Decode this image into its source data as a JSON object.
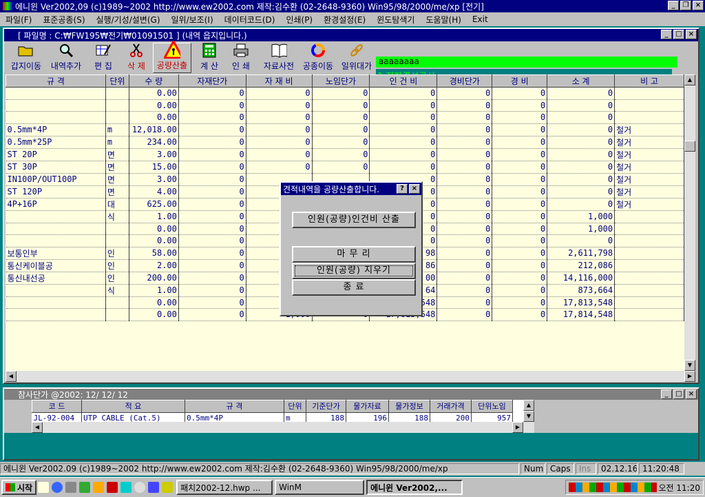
{
  "app": {
    "title": "에니윈 Ver2002,09 (c)1989~2002 http://www.ew2002.com 제작:김수환 (02-2648-9360) Win95/98/2000/me/xp [전기]"
  },
  "menu": [
    "파일(F)",
    "표준공종(S)",
    "실행/기성/설변(G)",
    "일위/보조(I)",
    "데이터코드(D)",
    "인쇄(P)",
    "환경설정(E)",
    "윈도탐색기",
    "도움말(H)",
    "Exit"
  ],
  "doc": {
    "title": "[ 파일명 : C:₩FW195₩전기₩01091501 ] (내역 읍지입니다.)"
  },
  "toolbar": [
    {
      "label": "갑지이동",
      "icon": "folder-open-icon"
    },
    {
      "label": "내역추가",
      "icon": "magnifier-icon"
    },
    {
      "label": "편 집",
      "icon": "edit-sheet-icon"
    },
    {
      "label": "삭 제",
      "icon": "scissors-icon"
    },
    {
      "label": "공량산출",
      "icon": "warning-worker-icon"
    },
    {
      "label": "계 산",
      "icon": "calculator-icon"
    },
    {
      "label": "인 쇄",
      "icon": "printer-icon"
    },
    {
      "label": "자료사전",
      "icon": "book-icon"
    },
    {
      "label": "공종이동",
      "icon": "color-ring-icon"
    },
    {
      "label": "일위대가",
      "icon": "chain-icon"
    }
  ],
  "status": {
    "line1": "aaaaaaaa",
    "line2": "1 전화결선공사"
  },
  "grid": {
    "headers": [
      "규  격",
      "단위",
      "수  량",
      "자재단가",
      "자 재 비",
      "노임단가",
      "인 건 비",
      "경비단가",
      "경  비",
      "소  계",
      "비  고"
    ],
    "rows": [
      [
        "",
        "",
        "0.00",
        "0",
        "0",
        "0",
        "0",
        "0",
        "0",
        "0",
        ""
      ],
      [
        "",
        "",
        "0.00",
        "0",
        "0",
        "0",
        "0",
        "0",
        "0",
        "0",
        ""
      ],
      [
        "",
        "",
        "0.00",
        "0",
        "0",
        "0",
        "0",
        "0",
        "0",
        "0",
        ""
      ],
      [
        "0.5mm*4P",
        "m",
        "12,018.00",
        "0",
        "0",
        "0",
        "0",
        "0",
        "0",
        "0",
        "철거"
      ],
      [
        "0.5mm*25P",
        "m",
        "234.00",
        "0",
        "0",
        "0",
        "0",
        "0",
        "0",
        "0",
        "철거"
      ],
      [
        "ST    20P",
        "면",
        "3.00",
        "0",
        "0",
        "0",
        "0",
        "0",
        "0",
        "0",
        "철거"
      ],
      [
        "ST    30P",
        "면",
        "15.00",
        "0",
        "0",
        "0",
        "0",
        "0",
        "0",
        "0",
        "철거"
      ],
      [
        "IN100P/OUT100P",
        "면",
        "3.00",
        "0",
        "",
        "",
        "0",
        "0",
        "0",
        "0",
        "철거"
      ],
      [
        "ST    120P",
        "면",
        "4.00",
        "0",
        "",
        "",
        "0",
        "0",
        "0",
        "0",
        "철거"
      ],
      [
        "4P+16P",
        "대",
        "625.00",
        "0",
        "",
        "",
        "0",
        "0",
        "0",
        "0",
        "철거"
      ],
      [
        "",
        "식",
        "1.00",
        "0",
        "",
        "",
        "0",
        "0",
        "0",
        "1,000",
        ""
      ],
      [
        "",
        "",
        "0.00",
        "0",
        "",
        "",
        "0",
        "0",
        "0",
        "1,000",
        ""
      ],
      [
        "",
        "",
        "0.00",
        "0",
        "",
        "",
        "0",
        "0",
        "0",
        "0",
        ""
      ],
      [
        "보통인부",
        "인",
        "58.00",
        "0",
        "",
        "",
        "98",
        "0",
        "0",
        "2,611,798",
        ""
      ],
      [
        "통신케이블공",
        "인",
        "2.00",
        "0",
        "",
        "",
        "86",
        "0",
        "0",
        "212,086",
        ""
      ],
      [
        "통신내선공",
        "인",
        "200.00",
        "0",
        "",
        "",
        "00",
        "0",
        "0",
        "14,116,000",
        ""
      ],
      [
        "",
        "식",
        "1.00",
        "0",
        "",
        "",
        "64",
        "0",
        "0",
        "873,664",
        ""
      ],
      [
        "",
        "",
        "0.00",
        "0",
        "",
        "",
        "548",
        "0",
        "0",
        "17,813,548",
        ""
      ],
      [
        "",
        "",
        "0.00",
        "0",
        "1,000",
        "0",
        "17,813,548",
        "0",
        "0",
        "17,814,548",
        ""
      ]
    ]
  },
  "dialog": {
    "title": "견적내역을 공량산출합니다.",
    "btn_calc": "인원(공량)인건비 산출",
    "btn_finish": "마 무 리",
    "btn_clear": "인원(공량) 지우기",
    "btn_close": "종  료"
  },
  "sub": {
    "title": "참사단가  @2002: 12/ 12/ 12",
    "headers": [
      "코  드",
      "적  요",
      "규  격",
      "단위",
      "기준단가",
      "물가자료",
      "물가정보",
      "거래가격",
      "단위노임"
    ],
    "row": [
      "JL-92-004",
      "UTP CABLE  (Cat.5)",
      "0.5mm*4P",
      "m",
      "188",
      "196",
      "188",
      "200",
      "957"
    ]
  },
  "statusbar": {
    "info": "에니윈 Ver2002.09 (c)1989~2002 http://www.ew2002.com 제작:김수환 (02-2648-9360) Win95/98/2000/me/xp",
    "num": "Num",
    "caps": "Caps",
    "ins": "Ins",
    "date": "02.12.16",
    "time": "11:20:48"
  },
  "taskbar": {
    "start": "시작",
    "items": [
      "패치2002-12.hwp ...",
      "WinM",
      "에니윈 Ver2002,..."
    ],
    "clock": "오전 11:20"
  }
}
